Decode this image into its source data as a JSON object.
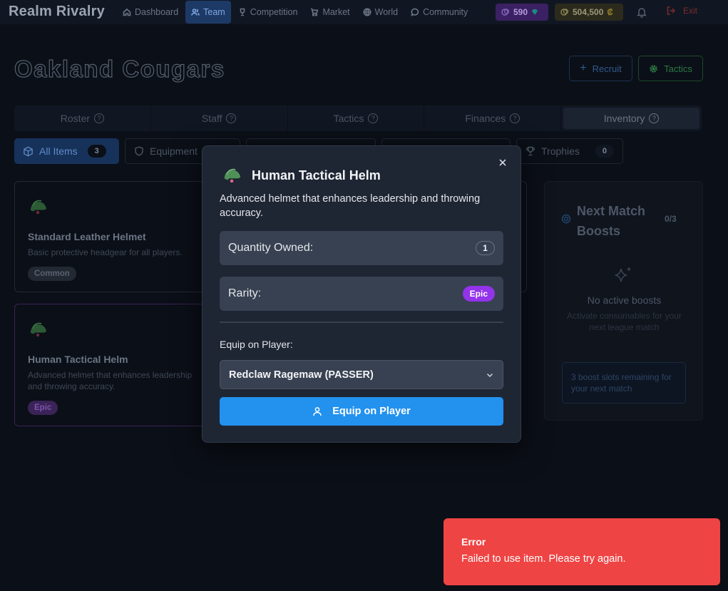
{
  "app": {
    "brand": "Realm Rivalry",
    "nav": [
      {
        "label": "Dashboard",
        "icon": "home-icon",
        "active": false
      },
      {
        "label": "Team",
        "icon": "users-icon",
        "active": true
      },
      {
        "label": "Competition",
        "icon": "trophy-icon",
        "active": false
      },
      {
        "label": "Market",
        "icon": "cart-icon",
        "active": false
      },
      {
        "label": "World",
        "icon": "globe-icon",
        "active": false
      },
      {
        "label": "Community",
        "icon": "chat-icon",
        "active": false
      }
    ],
    "gems": "590",
    "gold": "504,500",
    "exit_label": "Exit"
  },
  "header": {
    "team_name": "Oakland Cougars",
    "recruit_label": "Recruit",
    "tactics_label": "Tactics"
  },
  "tabs": [
    {
      "label": "Roster",
      "active": false
    },
    {
      "label": "Staff",
      "active": false
    },
    {
      "label": "Tactics",
      "active": false
    },
    {
      "label": "Finances",
      "active": false
    },
    {
      "label": "Inventory",
      "active": true
    }
  ],
  "filters": {
    "all": {
      "label": "All Items",
      "count": "3"
    },
    "equipment": {
      "label": "Equipment"
    },
    "trophies": {
      "label": "Trophies",
      "count": "0"
    }
  },
  "items": [
    {
      "name": "Standard Leather Helmet",
      "desc": "Basic protective headgear for all players.",
      "rarity": "Common"
    },
    {
      "name": "Human Tactical Helm",
      "desc": "Advanced helmet that enhances leadership and throwing accuracy.",
      "rarity": "Epic"
    }
  ],
  "boosts": {
    "title": "Next Match Boosts",
    "count": "0/3",
    "empty_title": "No active boosts",
    "empty_hint": "Activate consumables for your next league match",
    "slots_text": "3 boost slots remaining for your next match"
  },
  "modal": {
    "title": "Human Tactical Helm",
    "description": "Advanced helmet that enhances leadership and throwing accuracy.",
    "quantity_label": "Quantity Owned:",
    "quantity": "1",
    "rarity_label": "Rarity:",
    "rarity": "Epic",
    "equip_label": "Equip on Player:",
    "selected_player": "Redclaw Ragemaw (PASSER)",
    "equip_button": "Equip on Player"
  },
  "toast": {
    "title": "Error",
    "message": "Failed to use item. Please try again."
  },
  "colors": {
    "accent_blue": "#2391ee",
    "epic_purple": "#9333ea",
    "error_red": "#ef4444",
    "modal_bg": "#1e2533"
  }
}
